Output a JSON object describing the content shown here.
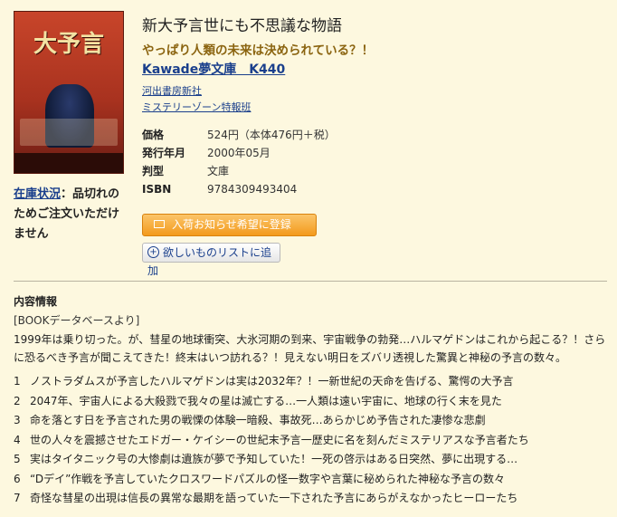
{
  "book": {
    "title": "新大予言世にも不思議な物語",
    "subtitle": "やっぱり人類の未来は決められている？！",
    "series": "Kawade夢文庫　K440",
    "publisher": "河出書房新社",
    "author": "ミステリーゾーン特報班",
    "cover_title": "大予言"
  },
  "stock": {
    "label": "在庫状況",
    "status": "：品切れのためご注文いただけません"
  },
  "specs": [
    {
      "key": "価格",
      "value": "524円（本体476円＋税）"
    },
    {
      "key": "発行年月",
      "value": "2000年05月"
    },
    {
      "key": "判型",
      "value": "文庫"
    },
    {
      "key": "ISBN",
      "value": "9784309493404"
    }
  ],
  "buttons": {
    "notify": "入荷お知らせ希望に登録",
    "wishlist": "欲しいものリストに追加"
  },
  "description": {
    "heading": "内容情報",
    "source": "[BOOKデータベースより]",
    "body": "1999年は乗り切った。が、彗星の地球衝突、大氷河期の到来、宇宙戦争の勃発…ハルマゲドンはこれから起こる？！さらに恐るべき予言が聞こえてきた！終末はいつ訪れる？！見えない明日をズバリ透視した驚異と神秘の予言の数々。",
    "toc": [
      {
        "n": "1",
        "text": "ノストラダムスが予言したハルマゲドンは実は2032年？！一新世紀の天命を告げる、驚愕の大予言"
      },
      {
        "n": "2",
        "text": "2047年、宇宙人による大殺戮で我々の星は滅亡する…一人類は遠い宇宙に、地球の行く末を見た"
      },
      {
        "n": "3",
        "text": "命を落とす日を予言された男の戦慄の体験一暗殺、事故死…あらかじめ予告された凄惨な悲劇"
      },
      {
        "n": "4",
        "text": "世の人々を震撼させたエドガー・ケイシーの世紀末予言一歴史に名を刻んだミステリアスな予言者たち"
      },
      {
        "n": "5",
        "text": "実はタイタニック号の大惨劇は遺族が夢で予知していた！一死の啓示はある日突然、夢に出現する…"
      },
      {
        "n": "6",
        "text": "“Dデイ”作戦を予言していたクロスワードパズルの怪一数字や言葉に秘められた神秘な予言の数々"
      },
      {
        "n": "7",
        "text": "奇怪な彗星の出現は信長の異常な最期を語っていた一下された予言にあらがえなかったヒーローたち"
      }
    ]
  },
  "icons": {
    "notify": "mail-icon",
    "wishlist": "plus-circle-icon"
  },
  "colors": {
    "background": "#fdf8df",
    "link": "#1a3f8c",
    "subtitle": "#8b6410",
    "notify_button": "#f39a1c"
  }
}
